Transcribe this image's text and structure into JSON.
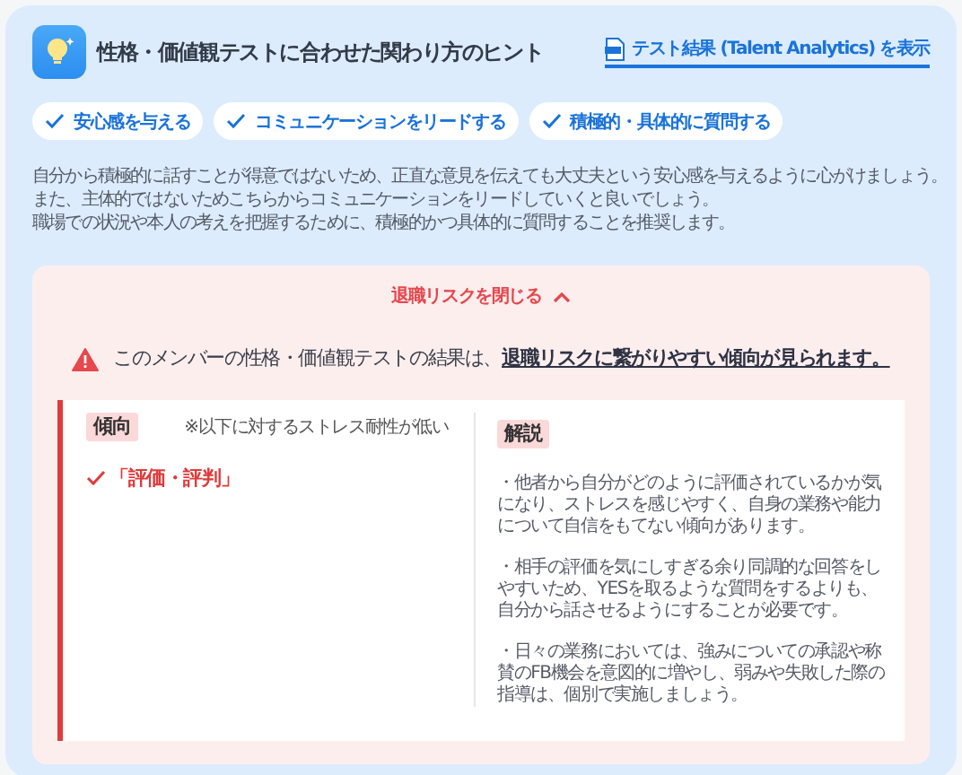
{
  "header": {
    "title": "性格・価値観テストに合わせた関わり方のヒント",
    "link": "テスト結果 (Talent Analytics) を表示"
  },
  "chips": [
    {
      "label": "安心感を与える"
    },
    {
      "label": "コミュニケーションをリードする"
    },
    {
      "label": "積極的・具体的に質問する"
    }
  ],
  "description": [
    "自分から積極的に話すことが得意ではないため、正直な意見を伝えても大丈夫という安心感を与えるように心がけましょう。",
    "また、主体的ではないためこちらからコミュニケーションをリードしていくと良いでしょう。",
    "職場での状況や本人の考えを把握するために、積極的かつ具体的に質問することを推奨します。"
  ],
  "risk": {
    "toggle": "退職リスクを閉じる",
    "expanded": true,
    "warning_text": "このメンバーの性格・価値観テストの結果は、",
    "warning_link": "退職リスクに繋がりやすい傾向が見られます。",
    "tendency": {
      "label": "傾向",
      "note": "※以下に対するストレス耐性が低い",
      "items": [
        "「評価・評判」"
      ]
    },
    "explanation": {
      "label": "解説",
      "paragraphs": [
        "・他者から自分がどのように評価されているかが気になり、ストレスを感じやすく、自身の業務や能力について自信をもてない傾向があります。",
        "・相手の評価を気にしすぎる余り同調的な回答をしやすいため、YESを取るような質問をするよりも、自分から話させるようにすることが必要です。",
        "・日々の業務においては、強みについての承認や称賛のFB機会を意図的に増やし、弱みや失敗した際の指導は、個別で実施しましょう。"
      ]
    }
  }
}
